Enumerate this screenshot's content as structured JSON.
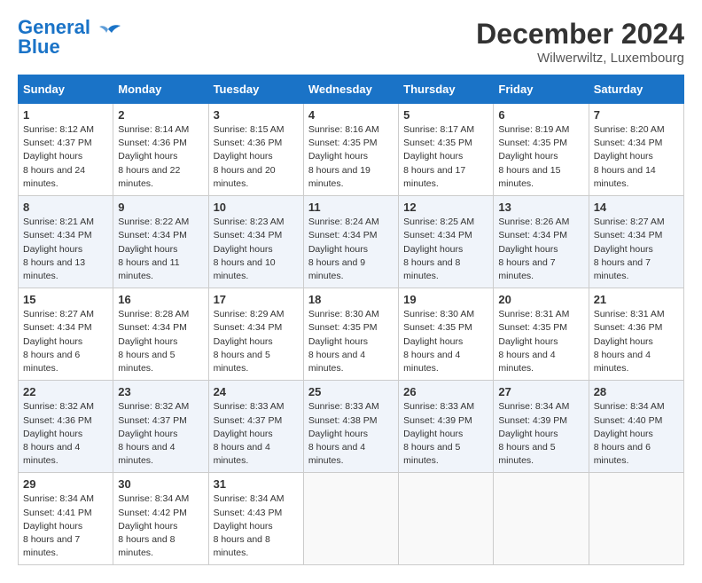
{
  "header": {
    "logo_line1": "General",
    "logo_line2": "Blue",
    "month": "December 2024",
    "location": "Wilwerwiltz, Luxembourg"
  },
  "weekdays": [
    "Sunday",
    "Monday",
    "Tuesday",
    "Wednesday",
    "Thursday",
    "Friday",
    "Saturday"
  ],
  "weeks": [
    [
      {
        "day": "1",
        "sunrise": "8:12 AM",
        "sunset": "4:37 PM",
        "daylight": "8 hours and 24 minutes."
      },
      {
        "day": "2",
        "sunrise": "8:14 AM",
        "sunset": "4:36 PM",
        "daylight": "8 hours and 22 minutes."
      },
      {
        "day": "3",
        "sunrise": "8:15 AM",
        "sunset": "4:36 PM",
        "daylight": "8 hours and 20 minutes."
      },
      {
        "day": "4",
        "sunrise": "8:16 AM",
        "sunset": "4:35 PM",
        "daylight": "8 hours and 19 minutes."
      },
      {
        "day": "5",
        "sunrise": "8:17 AM",
        "sunset": "4:35 PM",
        "daylight": "8 hours and 17 minutes."
      },
      {
        "day": "6",
        "sunrise": "8:19 AM",
        "sunset": "4:35 PM",
        "daylight": "8 hours and 15 minutes."
      },
      {
        "day": "7",
        "sunrise": "8:20 AM",
        "sunset": "4:34 PM",
        "daylight": "8 hours and 14 minutes."
      }
    ],
    [
      {
        "day": "8",
        "sunrise": "8:21 AM",
        "sunset": "4:34 PM",
        "daylight": "8 hours and 13 minutes."
      },
      {
        "day": "9",
        "sunrise": "8:22 AM",
        "sunset": "4:34 PM",
        "daylight": "8 hours and 11 minutes."
      },
      {
        "day": "10",
        "sunrise": "8:23 AM",
        "sunset": "4:34 PM",
        "daylight": "8 hours and 10 minutes."
      },
      {
        "day": "11",
        "sunrise": "8:24 AM",
        "sunset": "4:34 PM",
        "daylight": "8 hours and 9 minutes."
      },
      {
        "day": "12",
        "sunrise": "8:25 AM",
        "sunset": "4:34 PM",
        "daylight": "8 hours and 8 minutes."
      },
      {
        "day": "13",
        "sunrise": "8:26 AM",
        "sunset": "4:34 PM",
        "daylight": "8 hours and 7 minutes."
      },
      {
        "day": "14",
        "sunrise": "8:27 AM",
        "sunset": "4:34 PM",
        "daylight": "8 hours and 7 minutes."
      }
    ],
    [
      {
        "day": "15",
        "sunrise": "8:27 AM",
        "sunset": "4:34 PM",
        "daylight": "8 hours and 6 minutes."
      },
      {
        "day": "16",
        "sunrise": "8:28 AM",
        "sunset": "4:34 PM",
        "daylight": "8 hours and 5 minutes."
      },
      {
        "day": "17",
        "sunrise": "8:29 AM",
        "sunset": "4:34 PM",
        "daylight": "8 hours and 5 minutes."
      },
      {
        "day": "18",
        "sunrise": "8:30 AM",
        "sunset": "4:35 PM",
        "daylight": "8 hours and 4 minutes."
      },
      {
        "day": "19",
        "sunrise": "8:30 AM",
        "sunset": "4:35 PM",
        "daylight": "8 hours and 4 minutes."
      },
      {
        "day": "20",
        "sunrise": "8:31 AM",
        "sunset": "4:35 PM",
        "daylight": "8 hours and 4 minutes."
      },
      {
        "day": "21",
        "sunrise": "8:31 AM",
        "sunset": "4:36 PM",
        "daylight": "8 hours and 4 minutes."
      }
    ],
    [
      {
        "day": "22",
        "sunrise": "8:32 AM",
        "sunset": "4:36 PM",
        "daylight": "8 hours and 4 minutes."
      },
      {
        "day": "23",
        "sunrise": "8:32 AM",
        "sunset": "4:37 PM",
        "daylight": "8 hours and 4 minutes."
      },
      {
        "day": "24",
        "sunrise": "8:33 AM",
        "sunset": "4:37 PM",
        "daylight": "8 hours and 4 minutes."
      },
      {
        "day": "25",
        "sunrise": "8:33 AM",
        "sunset": "4:38 PM",
        "daylight": "8 hours and 4 minutes."
      },
      {
        "day": "26",
        "sunrise": "8:33 AM",
        "sunset": "4:39 PM",
        "daylight": "8 hours and 5 minutes."
      },
      {
        "day": "27",
        "sunrise": "8:34 AM",
        "sunset": "4:39 PM",
        "daylight": "8 hours and 5 minutes."
      },
      {
        "day": "28",
        "sunrise": "8:34 AM",
        "sunset": "4:40 PM",
        "daylight": "8 hours and 6 minutes."
      }
    ],
    [
      {
        "day": "29",
        "sunrise": "8:34 AM",
        "sunset": "4:41 PM",
        "daylight": "8 hours and 7 minutes."
      },
      {
        "day": "30",
        "sunrise": "8:34 AM",
        "sunset": "4:42 PM",
        "daylight": "8 hours and 8 minutes."
      },
      {
        "day": "31",
        "sunrise": "8:34 AM",
        "sunset": "4:43 PM",
        "daylight": "8 hours and 8 minutes."
      },
      null,
      null,
      null,
      null
    ]
  ]
}
